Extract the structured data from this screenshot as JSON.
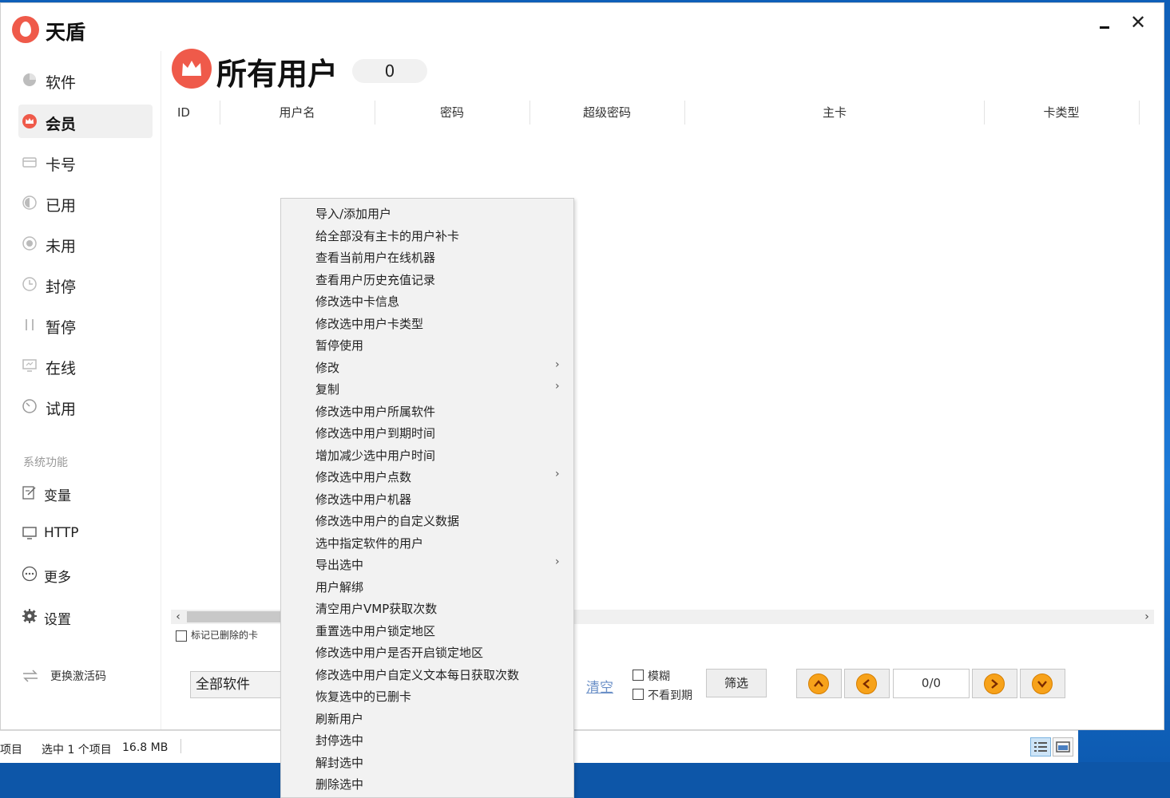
{
  "app": {
    "title": "天盾"
  },
  "sidebar": {
    "items": [
      {
        "label": "软件",
        "icon": "pie-icon"
      },
      {
        "label": "会员",
        "icon": "crown-icon"
      },
      {
        "label": "卡号",
        "icon": "card-icon"
      },
      {
        "label": "已用",
        "icon": "half-circle-icon"
      },
      {
        "label": "未用",
        "icon": "target-icon"
      },
      {
        "label": "封停",
        "icon": "clock-icon"
      },
      {
        "label": "暂停",
        "icon": "pause-icon"
      },
      {
        "label": "在线",
        "icon": "monitor-icon"
      },
      {
        "label": "试用",
        "icon": "timer-icon"
      }
    ],
    "section_label": "系统功能",
    "system_items": [
      {
        "label": "变量",
        "icon": "edit-icon"
      },
      {
        "label": "HTTP",
        "icon": "monitor-icon"
      },
      {
        "label": "更多",
        "icon": "more-icon"
      },
      {
        "label": "设置",
        "icon": "gear-icon"
      }
    ],
    "activate_label": "更换激活码"
  },
  "header": {
    "title": "所有用户",
    "count": "0"
  },
  "table": {
    "columns": [
      "ID",
      "用户名",
      "密码",
      "超级密码",
      "主卡",
      "卡类型"
    ]
  },
  "controls": {
    "mark_deleted_label": "标记已删除的卡",
    "software_select_value": "全部软件",
    "clear_label": "清空",
    "fuzzy_label": "模糊",
    "not_expired_label": "不看到期",
    "filter_label": "筛选",
    "page_indicator": "0/0"
  },
  "context_menu": {
    "items": [
      {
        "label": "导入/添加用户",
        "submenu": false
      },
      {
        "label": "给全部没有主卡的用户补卡",
        "submenu": false
      },
      {
        "label": "查看当前用户在线机器",
        "submenu": false
      },
      {
        "label": "查看用户历史充值记录",
        "submenu": false
      },
      {
        "label": "修改选中卡信息",
        "submenu": false
      },
      {
        "label": "修改选中用户卡类型",
        "submenu": false
      },
      {
        "label": "暂停使用",
        "submenu": false
      },
      {
        "label": "修改",
        "submenu": true
      },
      {
        "label": "复制",
        "submenu": true
      },
      {
        "label": "修改选中用户所属软件",
        "submenu": false
      },
      {
        "label": "修改选中用户到期时间",
        "submenu": false
      },
      {
        "label": "增加减少选中用户时间",
        "submenu": false
      },
      {
        "label": "修改选中用户点数",
        "submenu": true
      },
      {
        "label": "修改选中用户机器",
        "submenu": false
      },
      {
        "label": "修改选中用户的自定义数据",
        "submenu": false
      },
      {
        "label": "选中指定软件的用户",
        "submenu": false
      },
      {
        "label": "导出选中",
        "submenu": true
      },
      {
        "label": "用户解绑",
        "submenu": false
      },
      {
        "label": "清空用户VMP获取次数",
        "submenu": false
      },
      {
        "label": "重置选中用户锁定地区",
        "submenu": false
      },
      {
        "label": "修改选中用户是否开启锁定地区",
        "submenu": false
      },
      {
        "label": "修改选中用户自定义文本每日获取次数",
        "submenu": false
      },
      {
        "label": "恢复选中的已删卡",
        "submenu": false
      },
      {
        "label": "刷新用户",
        "submenu": false
      },
      {
        "label": "封停选中",
        "submenu": false
      },
      {
        "label": "解封选中",
        "submenu": false
      },
      {
        "label": "删除选中",
        "submenu": false
      }
    ],
    "submenu_glyph": "›"
  },
  "explorer_status": {
    "items_label": "项目",
    "selected_label": "选中 1 个项目",
    "size": "16.8 MB"
  },
  "colors": {
    "brand": "#ef5a4a",
    "pager_button": "#f7a21a",
    "link": "#6a8fc7"
  }
}
